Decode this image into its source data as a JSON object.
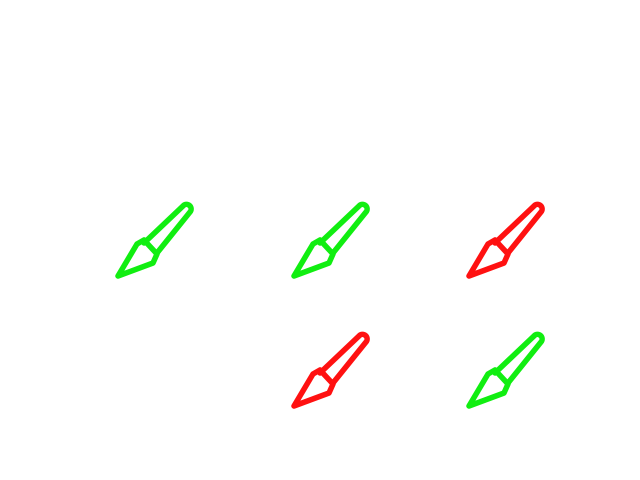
{
  "colors": {
    "green": "#11ee11",
    "red": "#ff1111"
  },
  "icons": [
    {
      "name": "brush-icon",
      "color": "green"
    },
    {
      "name": "brush-icon",
      "color": "green"
    },
    {
      "name": "brush-icon",
      "color": "red"
    },
    {
      "name": "brush-icon",
      "color": "red"
    },
    {
      "name": "brush-icon",
      "color": "green"
    }
  ]
}
